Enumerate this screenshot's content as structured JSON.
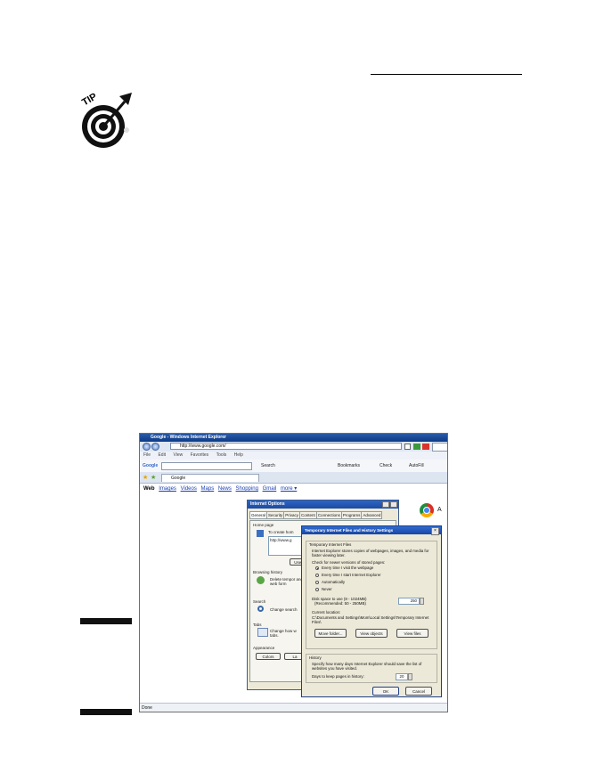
{
  "tip_label": "TIP",
  "browser": {
    "title": "Google - Windows Internet Explorer",
    "address": "http://www.google.com/",
    "menu": [
      "File",
      "Edit",
      "View",
      "Favorites",
      "Tools",
      "Help"
    ],
    "google_toolbar": {
      "logo": "Google",
      "items": [
        "Search",
        "Bookmarks",
        "Check",
        "AutoFill"
      ]
    },
    "tab_label": "Google",
    "google_nav": {
      "active": "Web",
      "links": [
        "Images",
        "Videos",
        "Maps",
        "News",
        "Shopping",
        "Gmail",
        "more ▾"
      ]
    },
    "side_letter": "A",
    "status": "Done"
  },
  "internet_options": {
    "title": "Internet Options",
    "tabs": [
      "General",
      "Security",
      "Privacy",
      "Content",
      "Connections",
      "Programs",
      "Advanced"
    ],
    "home_page_label": "Home page",
    "home_page_hint": "To create hom",
    "home_page_value": "http://www.g",
    "use_current": "Use c",
    "browsing_history_label": "Browsing history",
    "browsing_history_text": "Delete tempor and web form",
    "search_label": "Search",
    "search_text": "Change search",
    "tabs_label": "Tabs",
    "tabs_text": "Change how w tabs.",
    "appearance_label": "Appearance",
    "colors_button": "Colors",
    "languages_button": "La"
  },
  "temp_files_dialog": {
    "title": "Temporary Internet Files and History Settings",
    "tif_group": "Temporary Internet Files",
    "tif_desc": "Internet Explorer stores copies of webpages, images, and media for faster viewing later.",
    "check_label": "Check for newer versions of stored pages:",
    "options": [
      "Every time I visit the webpage",
      "Every time I start Internet Explorer",
      "Automatically",
      "Never"
    ],
    "selected_option": 0,
    "disk_label": "Disk space to use (8 - 1024MB)",
    "disk_recommended": "(Recommended: 50 - 250MB)",
    "disk_value": "250",
    "current_location_label": "Current location:",
    "current_location": "C:\\Documents and Settings\\Mom\\Local Settings\\Temporary Internet Files\\",
    "move_folder": "Move folder...",
    "view_objects": "View objects",
    "view_files": "View files",
    "history_group": "History",
    "history_desc": "Specify how many days Internet Explorer should save the list of websites you have visited.",
    "days_label": "Days to keep pages in history:",
    "days_value": "20",
    "ok": "OK",
    "cancel": "Cancel"
  }
}
